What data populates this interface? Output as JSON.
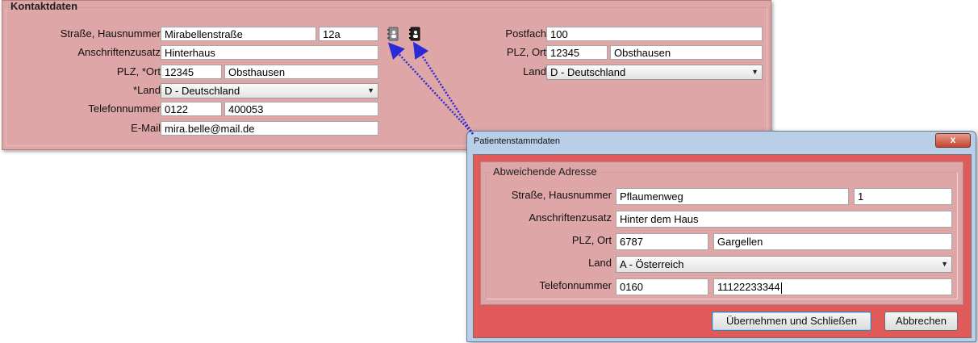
{
  "kontakt": {
    "legend": "Kontaktdaten",
    "labels": {
      "strasse": "Straße, Hausnummer",
      "zusatz": "Anschriftenzusatz",
      "plz_ort": "PLZ, *Ort",
      "land": "*Land",
      "telefon": "Telefonnummer",
      "email": "E-Mail",
      "postfach": "Postfach",
      "plz_ort_pf": "PLZ, Ort",
      "land_pf": "Land"
    },
    "values": {
      "strasse": "Mirabellenstraße",
      "hausnummer": "12a",
      "zusatz": "Hinterhaus",
      "plz": "12345",
      "ort": "Obsthausen",
      "land": "D - Deutschland",
      "vorwahl": "0122",
      "telefon": "400053",
      "email": "mira.belle@mail.de",
      "postfach": "100",
      "plz_pf": "12345",
      "ort_pf": "Obsthausen",
      "land_pf": "D - Deutschland"
    },
    "icons": [
      "address-card-icon-gray",
      "address-card-icon-dark"
    ]
  },
  "dialog": {
    "title": "Patientenstammdaten",
    "close_label": "x",
    "group_legend": "Abweichende Adresse",
    "labels": {
      "strasse": "Straße, Hausnummer",
      "zusatz": "Anschriftenzusatz",
      "plz_ort": "PLZ, Ort",
      "land": "Land",
      "telefon": "Telefonnummer"
    },
    "values": {
      "strasse": "Pflaumenweg",
      "hausnummer": "1",
      "zusatz": "Hinter dem Haus",
      "plz": "6787",
      "ort": "Gargellen",
      "land": "A - Österreich",
      "vorwahl": "0160",
      "telefon": "11122233344"
    },
    "buttons": {
      "apply": "Übernehmen und Schließen",
      "cancel": "Abbrechen"
    }
  },
  "colors": {
    "panel_bg": "#dea6a6",
    "dialog_body_bg": "#e05a5a",
    "dialog_frame_bg": "#b9cfe8",
    "arrow": "#2a2ad6"
  }
}
